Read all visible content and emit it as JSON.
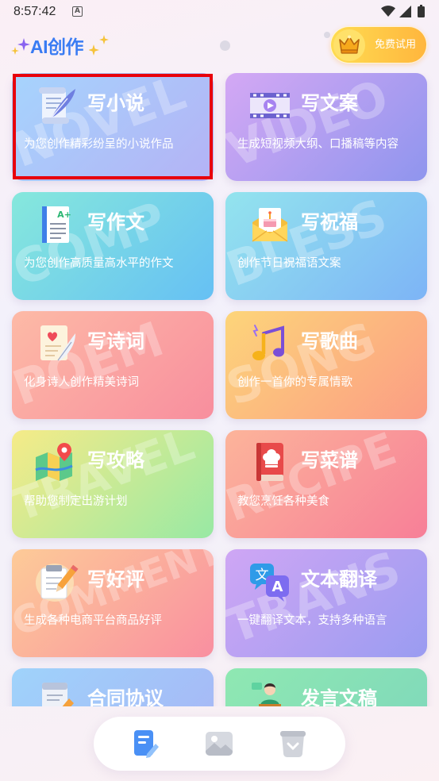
{
  "status_bar": {
    "time": "8:57:42",
    "notification_glyph": "A",
    "icons": [
      "notification-a-icon",
      "wifi-icon",
      "signal-icon",
      "battery-icon"
    ]
  },
  "header": {
    "logo_text": "AI创作",
    "trial_button": {
      "label": "免费试用",
      "icon": "crown-icon"
    }
  },
  "cards": [
    {
      "title": "写小说",
      "subtitle": "为您创作精彩纷呈的小说作品",
      "watermark": "NOVEL",
      "icon": "scroll-quill-icon",
      "gradient": [
        "#a6d4fd",
        "#b4b2f5"
      ],
      "selected": true
    },
    {
      "title": "写文案",
      "subtitle": "生成短视频大纲、口播稿等内容",
      "watermark": "VIDEO",
      "icon": "film-play-icon",
      "gradient": [
        "#d4a8f4",
        "#8f95ee"
      ]
    },
    {
      "title": "写作文",
      "subtitle": "为您创作高质量高水平的作文",
      "watermark": "COMP",
      "icon": "document-a-plus-icon",
      "icon_text": "A+",
      "gradient": [
        "#86e8dc",
        "#66c0f4"
      ]
    },
    {
      "title": "写祝福",
      "subtitle": "创作节日祝福语文案",
      "watermark": "BLESS",
      "icon": "envelope-cake-icon",
      "gradient": [
        "#93e4ee",
        "#7db4f6"
      ]
    },
    {
      "title": "写诗词",
      "subtitle": "化身诗人创作精美诗词",
      "watermark": "POEM",
      "icon": "letter-heart-quill-icon",
      "gradient": [
        "#fdbaa6",
        "#f88e9e"
      ]
    },
    {
      "title": "写歌曲",
      "subtitle": "创作一首你的专属情歌",
      "watermark": "SONG",
      "icon": "music-notes-icon",
      "gradient": [
        "#fdd57a",
        "#fb9c84"
      ]
    },
    {
      "title": "写攻略",
      "subtitle": "帮助您制定出游计划",
      "watermark": "TRAVEL",
      "icon": "map-pin-icon",
      "gradient": [
        "#f6eb88",
        "#98e9a4"
      ]
    },
    {
      "title": "写菜谱",
      "subtitle": "教您烹饪各种美食",
      "watermark": "RECIPE",
      "icon": "recipe-book-icon",
      "gradient": [
        "#fcb49a",
        "#f77f98"
      ]
    },
    {
      "title": "写好评",
      "subtitle": "生成各种电商平台商品好评",
      "watermark": "COMMENT",
      "icon": "notepad-pencil-icon",
      "gradient": [
        "#fdcb98",
        "#f98fa0"
      ]
    },
    {
      "title": "文本翻译",
      "subtitle": "一键翻译文本，支持多种语言",
      "watermark": "TRANS",
      "icon": "translate-icon",
      "icon_text": [
        "文",
        "A"
      ],
      "gradient": [
        "#cfa6f4",
        "#9a9cf1"
      ]
    },
    {
      "title": "合同协议",
      "icon": "contract-pen-icon",
      "gradient": [
        "#9fd3fb",
        "#a8b3f5"
      ]
    },
    {
      "title": "发言文稿",
      "icon": "podium-speaker-icon",
      "gradient": [
        "#8fe8b2",
        "#7dd6bc"
      ]
    }
  ],
  "bottom_nav": {
    "items": [
      {
        "icon": "document-edit-icon",
        "active": true
      },
      {
        "icon": "image-icon",
        "active": false
      },
      {
        "icon": "bag-icon",
        "active": false
      }
    ]
  },
  "colors": {
    "active_nav": "#4a90f5",
    "inactive_nav": "#cfd2d9",
    "selection_border": "#e8000c",
    "logo": "#3a7cf3",
    "trial_gradient": [
      "#ffdc52",
      "#ffb63d"
    ]
  }
}
